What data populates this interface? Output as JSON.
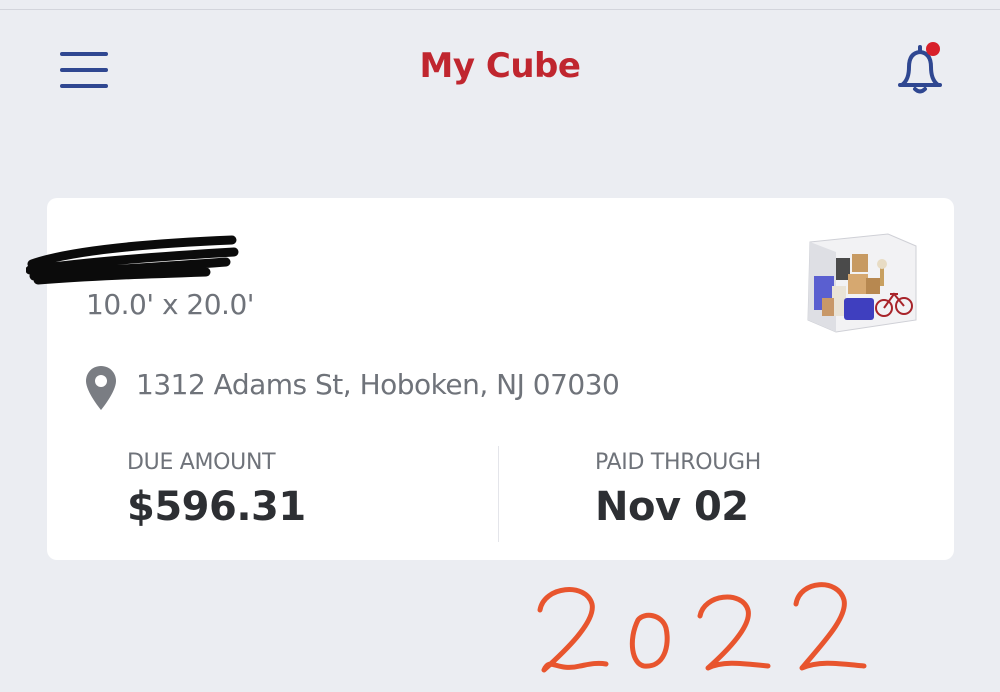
{
  "header": {
    "title": "My Cube",
    "menu_icon": "hamburger-menu-icon",
    "notification_icon": "bell-icon",
    "has_unread_notification": true
  },
  "unit": {
    "size": "10.0' x 20.0'",
    "address": "1312 Adams St, Hoboken, NJ 07030",
    "location_icon": "map-pin-icon",
    "due_amount_label": "DUE AMOUNT",
    "due_amount_value": "$596.31",
    "paid_through_label": "PAID THROUGH",
    "paid_through_value": "Nov 02"
  },
  "annotation": {
    "handwritten_text": "2022"
  },
  "colors": {
    "background": "#ebedf2",
    "brand_red": "#c0262f",
    "nav_blue": "#2f4791",
    "notification_dot": "#d8202a",
    "handwriting_red": "#e8552e",
    "muted_text": "#6f737a",
    "value_text": "#2d2f33"
  }
}
